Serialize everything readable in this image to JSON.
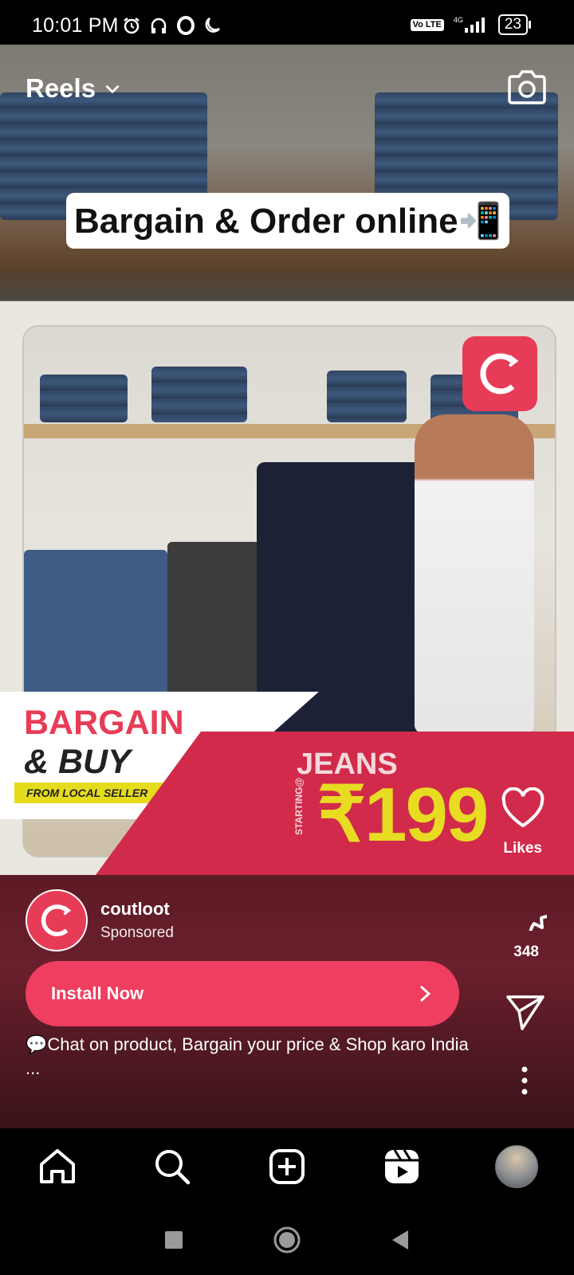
{
  "status_bar": {
    "time": "10:01 PM",
    "volte": "Vo LTE",
    "network": "4G",
    "battery": "23"
  },
  "header": {
    "title": "Reels"
  },
  "reel": {
    "caption_overlay": "Bargain & Order online📲",
    "ad": {
      "line1": "BARGAIN",
      "line2": "& BUY",
      "tag": "FROM LOCAL SELLER",
      "product": "JEANS",
      "starting": "STARTING@",
      "price": "₹199"
    },
    "side": {
      "likes_label": "Likes",
      "comments_count": "348"
    },
    "author": {
      "name": "coutloot",
      "sponsored": "Sponsored"
    },
    "cta": {
      "label": "Install Now"
    },
    "description": "💬Chat on product, Bargain your price & Shop karo India",
    "more": "..."
  },
  "colors": {
    "brand": "#e73c57",
    "cta": "#ef3e5f",
    "price_yellow": "#e7dc22"
  },
  "nav": {
    "items": [
      "home-icon",
      "search-icon",
      "create-icon",
      "reels-icon",
      "profile-avatar"
    ]
  }
}
